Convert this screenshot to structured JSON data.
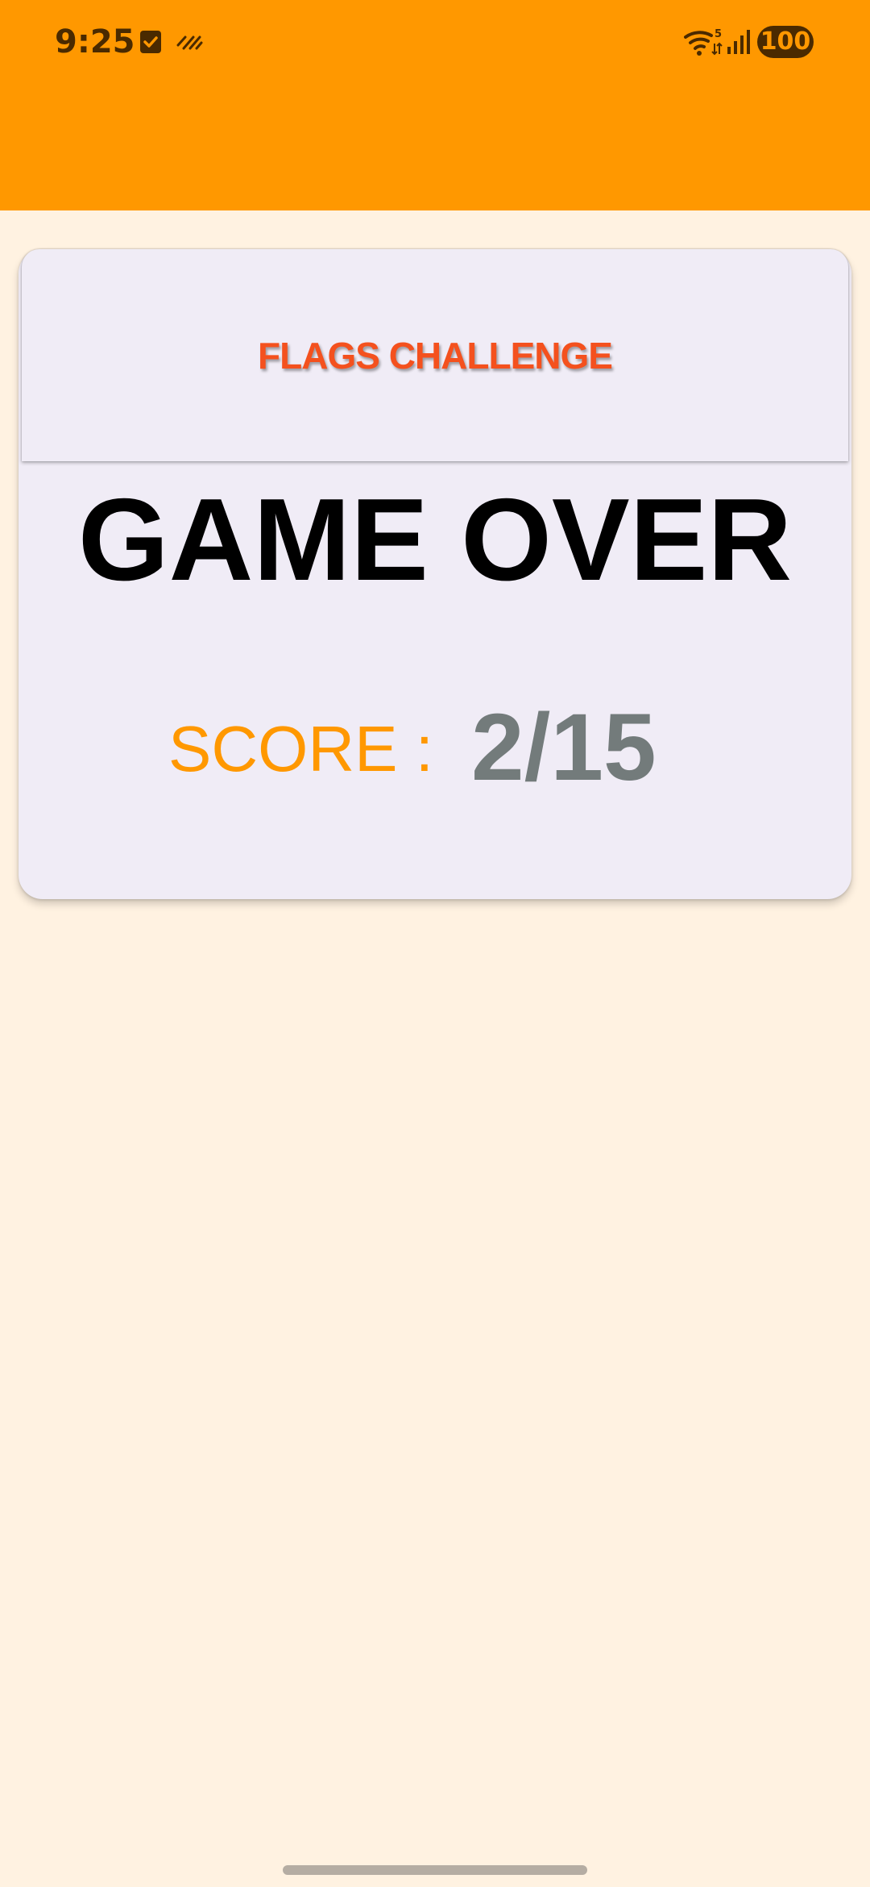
{
  "status_bar": {
    "time": "9:25",
    "battery": "100",
    "wifi_badge": "5",
    "icons": [
      "check-box-icon",
      "haptic-icon",
      "wifi-icon",
      "signal-icon",
      "battery-icon"
    ]
  },
  "header": {
    "title": "FLAGS CHALLENGE"
  },
  "result": {
    "heading": "GAME OVER",
    "score_label": "SCORE :",
    "score_value": "2/15"
  },
  "colors": {
    "app_bar": "#FF9800",
    "background": "#FFF2E1",
    "card": "#F0ECF6",
    "title": "#F4511E",
    "score_label": "#FF9800",
    "score_value": "#737B7B"
  }
}
